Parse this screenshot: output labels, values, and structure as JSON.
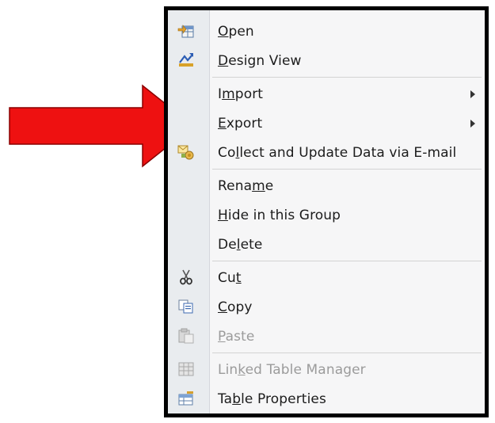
{
  "menu": {
    "items": [
      {
        "pre": "",
        "key": "O",
        "post": "pen",
        "icon": "open-icon",
        "enabled": true
      },
      {
        "pre": "",
        "key": "D",
        "post": "esign View",
        "icon": "design-view-icon",
        "enabled": true
      },
      {
        "pre": "I",
        "key": "m",
        "post": "port",
        "icon": "",
        "enabled": true,
        "submenu": true
      },
      {
        "pre": "",
        "key": "E",
        "post": "xport",
        "icon": "",
        "enabled": true,
        "submenu": true
      },
      {
        "pre": "Co",
        "key": "l",
        "post": "lect and Update Data via E-mail",
        "icon": "collect-data-icon",
        "enabled": true
      },
      {
        "pre": "Rena",
        "key": "m",
        "post": "e",
        "icon": "",
        "enabled": true
      },
      {
        "pre": "",
        "key": "H",
        "post": "ide in this Group",
        "icon": "",
        "enabled": true
      },
      {
        "pre": "De",
        "key": "l",
        "post": "ete",
        "icon": "",
        "enabled": true
      },
      {
        "pre": "Cu",
        "key": "t",
        "post": "",
        "icon": "scissors-icon",
        "enabled": true
      },
      {
        "pre": "",
        "key": "C",
        "post": "opy",
        "icon": "copy-icon",
        "enabled": true
      },
      {
        "pre": "",
        "key": "P",
        "post": "aste",
        "icon": "paste-icon",
        "enabled": false
      },
      {
        "pre": "Lin",
        "key": "k",
        "post": "ed Table Manager",
        "icon": "linked-table-icon",
        "enabled": false
      },
      {
        "pre": "Ta",
        "key": "b",
        "post": "le Properties",
        "icon": "table-properties-icon",
        "enabled": true
      }
    ]
  },
  "colors": {
    "arrow": "#ee1111",
    "menu_border": "#000000",
    "menu_bg": "#f6f6f7",
    "gutter_bg": "#e9ecef",
    "disabled_text": "#9b9b9b"
  }
}
